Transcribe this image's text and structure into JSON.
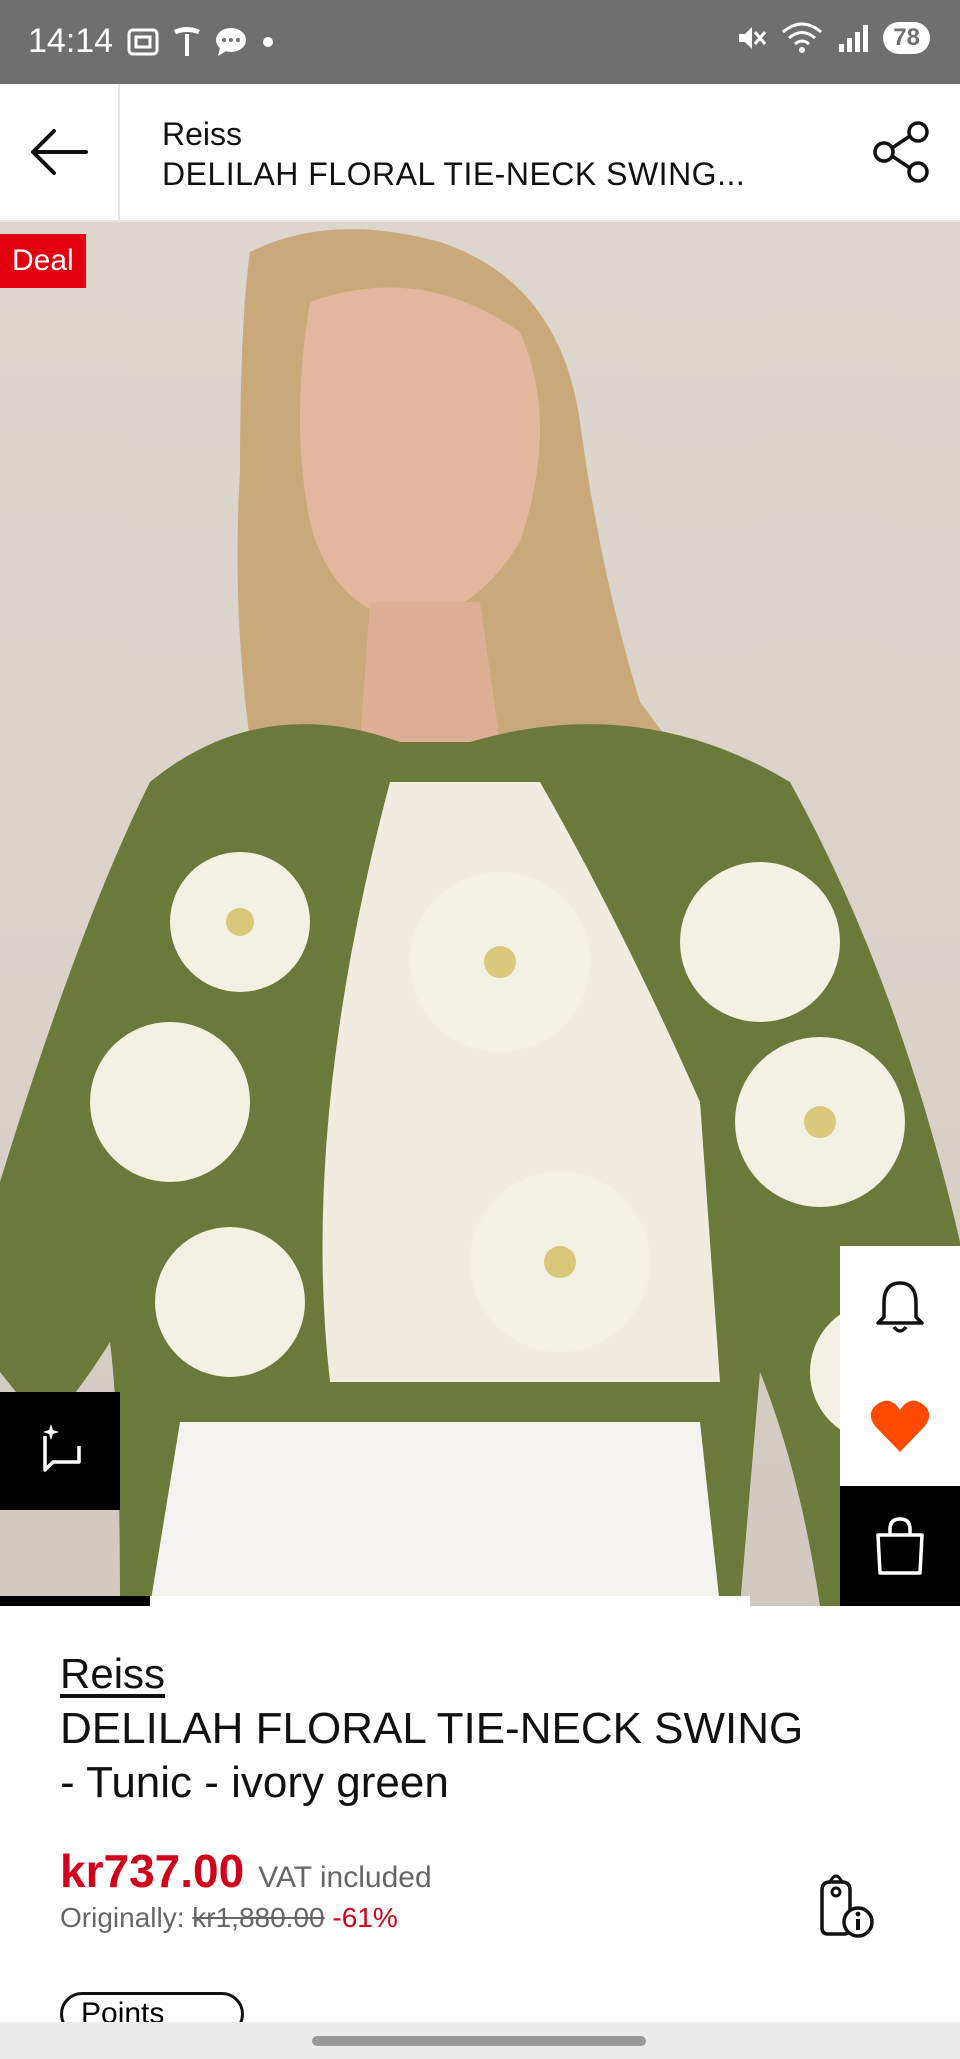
{
  "status_bar": {
    "time": "14:14",
    "battery": "78"
  },
  "app_bar": {
    "brand": "Reiss",
    "product_title": "DELILAH FLORAL TIE-NECK SWING..."
  },
  "hero": {
    "deal_label": "Deal",
    "gallery_progress": 0.2
  },
  "product": {
    "brand": "Reiss",
    "name": "DELILAH FLORAL TIE-NECK SWING - Tunic - ivory green",
    "price": "kr737.00",
    "vat": "VAT included",
    "originally_label": "Originally:",
    "original_price": "kr1,880.00",
    "discount": "-61%"
  },
  "points": {
    "label": "Points"
  },
  "colors": {
    "accent_red": "#d0021b",
    "deal_red": "#e3000f",
    "heart_orange": "#ff4a00"
  }
}
